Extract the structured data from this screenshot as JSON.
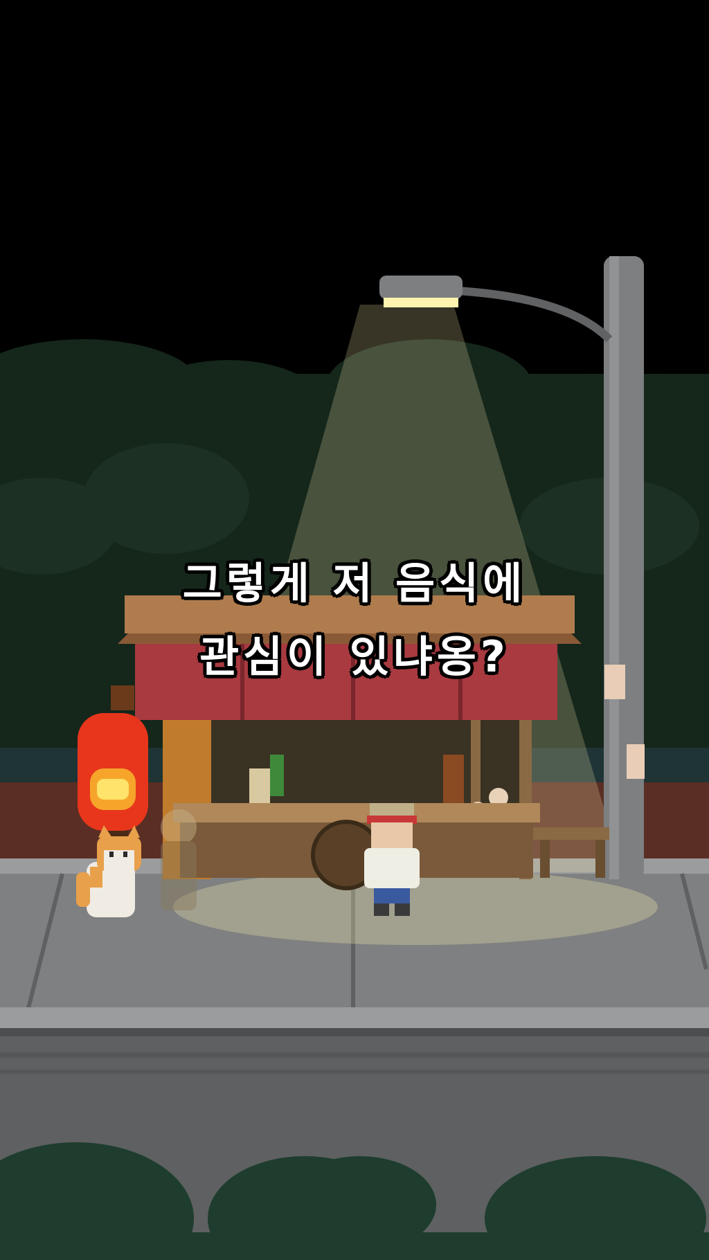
{
  "dialogue": {
    "line1": "그렇게 저 음식에",
    "line2": "관심이 있냐옹?"
  },
  "colors": {
    "sky": "#000000",
    "trees": "#16271c",
    "lamp_glow": "#fff3b0",
    "lantern": "#e8361c",
    "sidewalk": "#7d7f80",
    "road": "#5f6163",
    "stall_roof": "#b07c4e",
    "awning": "#a83a40"
  },
  "icons": [
    "street-lamp-icon",
    "paper-lantern-icon",
    "cat-icon",
    "player-character-icon",
    "food-stall-icon"
  ]
}
